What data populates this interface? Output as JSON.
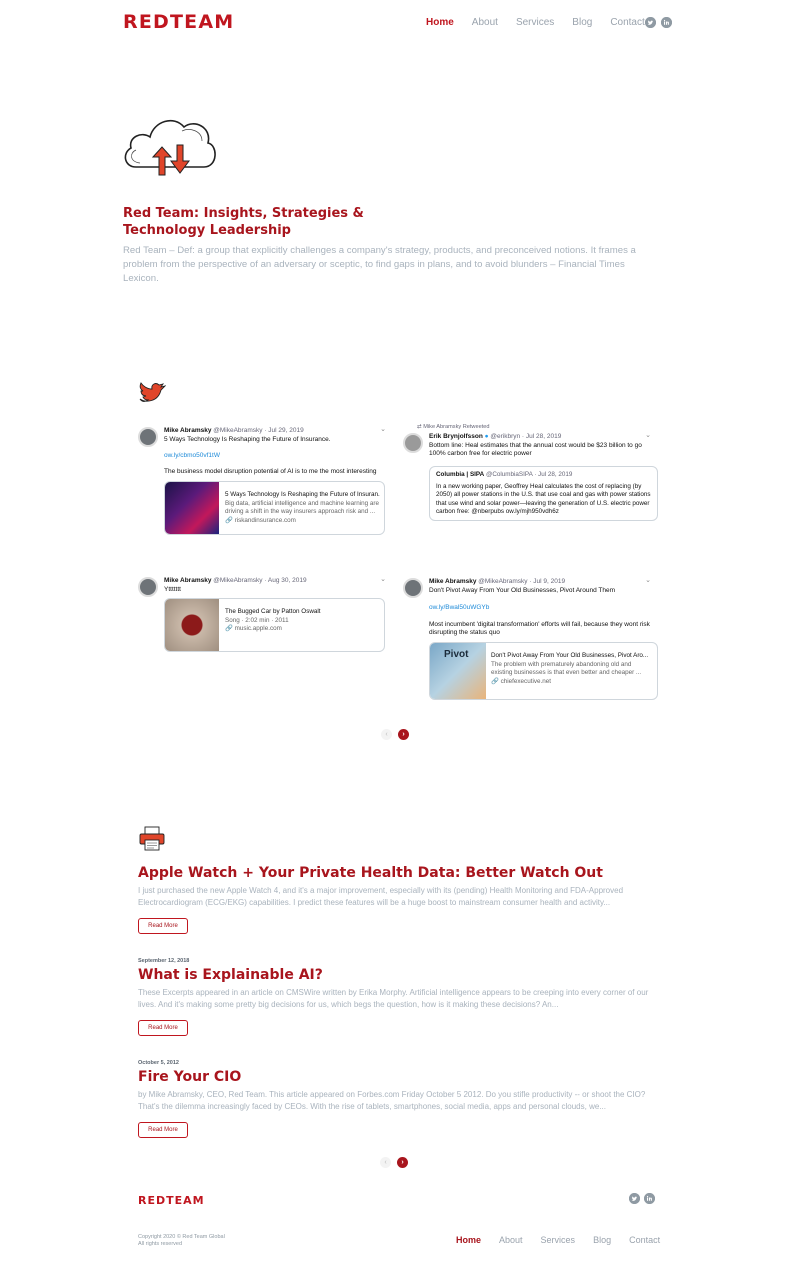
{
  "header": {
    "logo": "REDTEAM",
    "nav": [
      "Home",
      "About",
      "Services",
      "Blog",
      "Contact"
    ],
    "active_nav": "Home",
    "social": [
      "twitter-icon",
      "linkedin-icon"
    ]
  },
  "hero": {
    "title": "Red Team: Insights, Strategies & Technology Leadership",
    "description": "Red Team – Def: a group that explicitly challenges a company's strategy, products, and preconceived notions. It frames a problem from the perspective of an adversary or sceptic, to find gaps in plans, and to avoid blunders – Financial Times Lexicon."
  },
  "tweets": [
    {
      "name": "Mike Abramsky",
      "handle": "@MikeAbramsky",
      "date": "· Jul 29, 2019",
      "text": "5 Ways Technology Is Reshaping the Future of Insurance.",
      "link": "ow.ly/cbmo50vf1tW",
      "text2": "The business model disruption potential of AI is to me the most interesting",
      "card": {
        "title": "5 Ways Technology Is Reshaping the Future of Insuran...",
        "desc": "Big data, artificial intelligence and machine learning are driving a shift in the way insurers approach risk and ...",
        "source": "riskandinsurance.com"
      }
    },
    {
      "retweet_label": "Mike Abramsky Retweeted",
      "name": "Erik Brynjolfsson",
      "handle": "@erikbryn",
      "date": "· Jul 28, 2019",
      "text": "Bottom line: Heal estimates that the annual cost would be $23 billion to go 100% carbon free for electric power",
      "quote": {
        "name": "Columbia | SIPA",
        "handle": "@ColumbiaSIPA · Jul 28, 2019",
        "text": "In a new working paper, Geoffrey Heal calculates the cost of replacing (by 2050) all power stations in the U.S. that use coal and gas with power stations that use wind and solar power—leaving the generation of U.S. electric power carbon free: @nberpubs ow.ly/mjh950vdh6z"
      }
    },
    {
      "name": "Mike Abramsky",
      "handle": "@MikeAbramsky",
      "date": "· Aug 30, 2019",
      "text": "Yttttttt",
      "card": {
        "title": "The Bugged Car by Patton Oswalt",
        "desc": "Song · 2:02 min · 2011",
        "source": "music.apple.com"
      }
    },
    {
      "name": "Mike Abramsky",
      "handle": "@MikeAbramsky",
      "date": "· Jul 9, 2019",
      "text": "Don't Pivot Away From Your Old Businesses, Pivot Around Them",
      "link": "ow.ly/Bwal50uWGYb",
      "text2": "Most incumbent 'digital transformation' efforts will fail, because they wont risk disrupting the status quo",
      "card": {
        "title": "Don't Pivot Away From Your Old Businesses, Pivot Aro...",
        "desc": "The problem with prematurely abandoning old and existing businesses is that even better and cheaper ...",
        "source": "chiefexecutive.net",
        "thumb_text": "Pivot"
      }
    }
  ],
  "posts": [
    {
      "date": "",
      "title": "Apple Watch + Your Private Health Data: Better Watch Out",
      "desc": "I just purchased the new Apple Watch 4, and it's a major improvement, especially with its (pending) Health Monitoring and FDA-Approved Electrocardiogram (ECG/EKG) capabilities. I predict these features will be a huge boost to mainstream consumer health and activity...",
      "button": "Read More"
    },
    {
      "date": "September 12, 2018",
      "title": "What is Explainable AI?",
      "desc": "These Excerpts appeared in an article on CMSWire written by Erika Morphy. Artificial intelligence appears to be creeping into every corner of our lives. And it's making some pretty big decisions for us, which begs the question, how is it making these decisions? An...",
      "button": "Read More"
    },
    {
      "date": "October 5, 2012",
      "title": "Fire Your CIO",
      "desc": "by Mike Abramsky, CEO, Red Team. This article appeared on Forbes.com Friday October 5 2012. Do you stifle productivity -- or shoot the CIO? That's the dilemma increasingly faced by CEOs. With the rise of tablets, smartphones, social media, apps and personal clouds, we...",
      "button": "Read More"
    }
  ],
  "pager": {
    "prev": "‹",
    "next": "›"
  },
  "footer": {
    "logo": "REDTEAM",
    "copyright_line1": "Copyright 2020 © Red Team Global",
    "copyright_line2": "All rights reserved",
    "nav": [
      "Home",
      "About",
      "Services",
      "Blog",
      "Contact"
    ]
  },
  "colors": {
    "brand": "#c0161f",
    "title": "#a8151d",
    "muted": "#a9b3bd",
    "link": "#1d8ad8"
  }
}
